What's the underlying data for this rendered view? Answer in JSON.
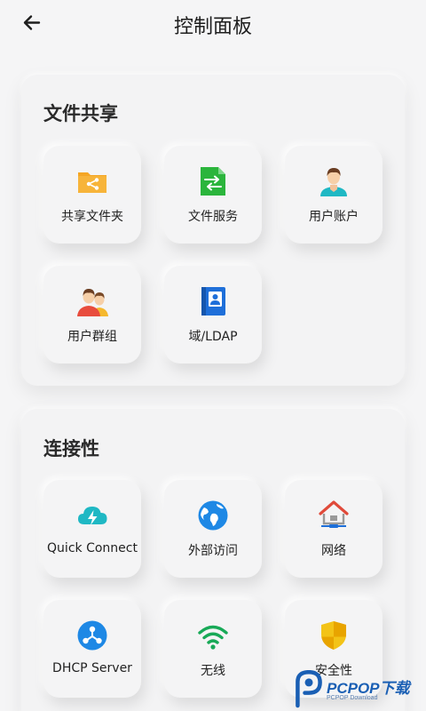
{
  "header": {
    "title": "控制面板"
  },
  "sections": [
    {
      "title": "文件共享",
      "items": [
        {
          "label": "共享文件夹",
          "icon": "shared-folder-icon"
        },
        {
          "label": "文件服务",
          "icon": "file-service-icon"
        },
        {
          "label": "用户账户",
          "icon": "user-account-icon"
        },
        {
          "label": "用户群组",
          "icon": "user-group-icon"
        },
        {
          "label": "域/LDAP",
          "icon": "domain-ldap-icon"
        }
      ]
    },
    {
      "title": "连接性",
      "items": [
        {
          "label": "Quick Connect",
          "icon": "quick-connect-icon"
        },
        {
          "label": "外部访问",
          "icon": "external-access-icon"
        },
        {
          "label": "网络",
          "icon": "network-icon"
        },
        {
          "label": "DHCP Server",
          "icon": "dhcp-server-icon"
        },
        {
          "label": "无线",
          "icon": "wireless-icon"
        },
        {
          "label": "安全性",
          "icon": "security-icon"
        }
      ]
    }
  ],
  "watermark": {
    "text": "PCPOP下载",
    "sub": "PCPOP Download"
  },
  "colors": {
    "folder": "#f5a623",
    "file_service": "#2bb53c",
    "cloud": "#1fb8c4",
    "globe": "#1e88e5",
    "network_roof": "#e04a3a",
    "shield": "#f3c317",
    "wifi": "#18a957"
  }
}
